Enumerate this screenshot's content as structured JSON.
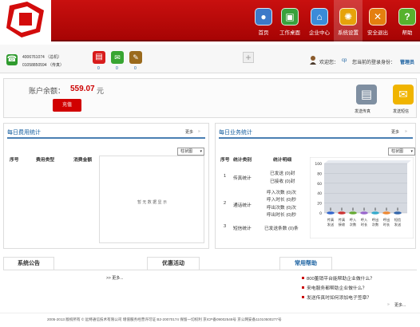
{
  "nav": [
    {
      "label": "首页",
      "icon": "person-icon"
    },
    {
      "label": "工作桌面",
      "icon": "desktop-icon"
    },
    {
      "label": "企业中心",
      "icon": "home-icon"
    },
    {
      "label": "系统设置",
      "icon": "gear-icon"
    },
    {
      "label": "安全退出",
      "icon": "exit-icon"
    },
    {
      "label": "帮助",
      "icon": "help-icon"
    }
  ],
  "contacts": {
    "phone": "4006761074 （总机）",
    "fax": "01058850594 （传真）"
  },
  "counts": [
    "0",
    "0",
    "0"
  ],
  "welcome": {
    "text": "欢迎您：",
    "user": "cp",
    "identity_label": "您当前的登录身份：",
    "identity": "管理员"
  },
  "account": {
    "label": "账户余额：",
    "amount": "559.07",
    "unit": "元",
    "recharge": "充值"
  },
  "actions": {
    "fax": "发送传真",
    "sms": "发送短信"
  },
  "daily_cost": {
    "title": "每日费用统计",
    "more": "更多",
    "chart_type": "柱状图",
    "headers": [
      "序号",
      "费用类型",
      "消费金额"
    ],
    "placeholder": "暂 无 数 据 显 示"
  },
  "daily_business": {
    "title": "每日业务统计",
    "more": "更多",
    "chart_type": "柱状图",
    "headers": [
      "序号",
      "统计类别",
      "统计明细"
    ],
    "rows": [
      {
        "no": "1",
        "type": "传真统计",
        "details": [
          "已发送 (0)封",
          "已接收 (0)封"
        ]
      },
      {
        "no": "2",
        "type": "通话统计",
        "details": [
          "呼入次数 (0)次",
          "呼入时长 (0)秒",
          "呼出次数 (0)次",
          "呼出时长 (0)秒"
        ]
      },
      {
        "no": "3",
        "type": "短信统计",
        "details": [
          "已发送条数 (0)条"
        ]
      }
    ]
  },
  "chart_data": {
    "type": "bar",
    "categories": [
      "传真发送",
      "传真接收",
      "呼入次数",
      "呼入时长",
      "呼出次数",
      "呼出时长",
      "短信发送"
    ],
    "values": [
      0,
      0,
      0,
      0,
      0,
      0,
      0
    ],
    "ylim": [
      0,
      100
    ],
    "ticks": [
      "100",
      "80",
      "60",
      "40",
      "20",
      "0"
    ],
    "xlabels": [
      "传真",
      "传真",
      "呼入",
      "呼入",
      "呼出",
      "呼出",
      "短信"
    ],
    "xlabels2": [
      "发送",
      "接收",
      "次数",
      "时长",
      "次数",
      "时长",
      "发送"
    ],
    "colors": [
      "#3366cc",
      "#cc3333",
      "#66aa33",
      "#9966cc",
      "#33aacc",
      "#ee8833",
      "#3366aa"
    ],
    "values_label": [
      "0",
      "0",
      "0",
      "0",
      "0",
      "0",
      "0"
    ]
  },
  "tabs": {
    "notice": "系统公告",
    "offers": "优惠活动",
    "help": "常用帮助"
  },
  "more_links": {
    "left": ">> 更多...",
    "right": "更多..."
  },
  "help_links": [
    "800董销平台能帮助企业做什么？",
    "来电服务都帮助企业做什么？",
    "发送传真时如何添加电子签章？"
  ],
  "footer": "2005-2013 版权所有 © 远特通信技术有限公司 增值服务经营许可证 B2-20070174 保留一切权利 京ICP备09002548号 京公网安备11010500277号"
}
